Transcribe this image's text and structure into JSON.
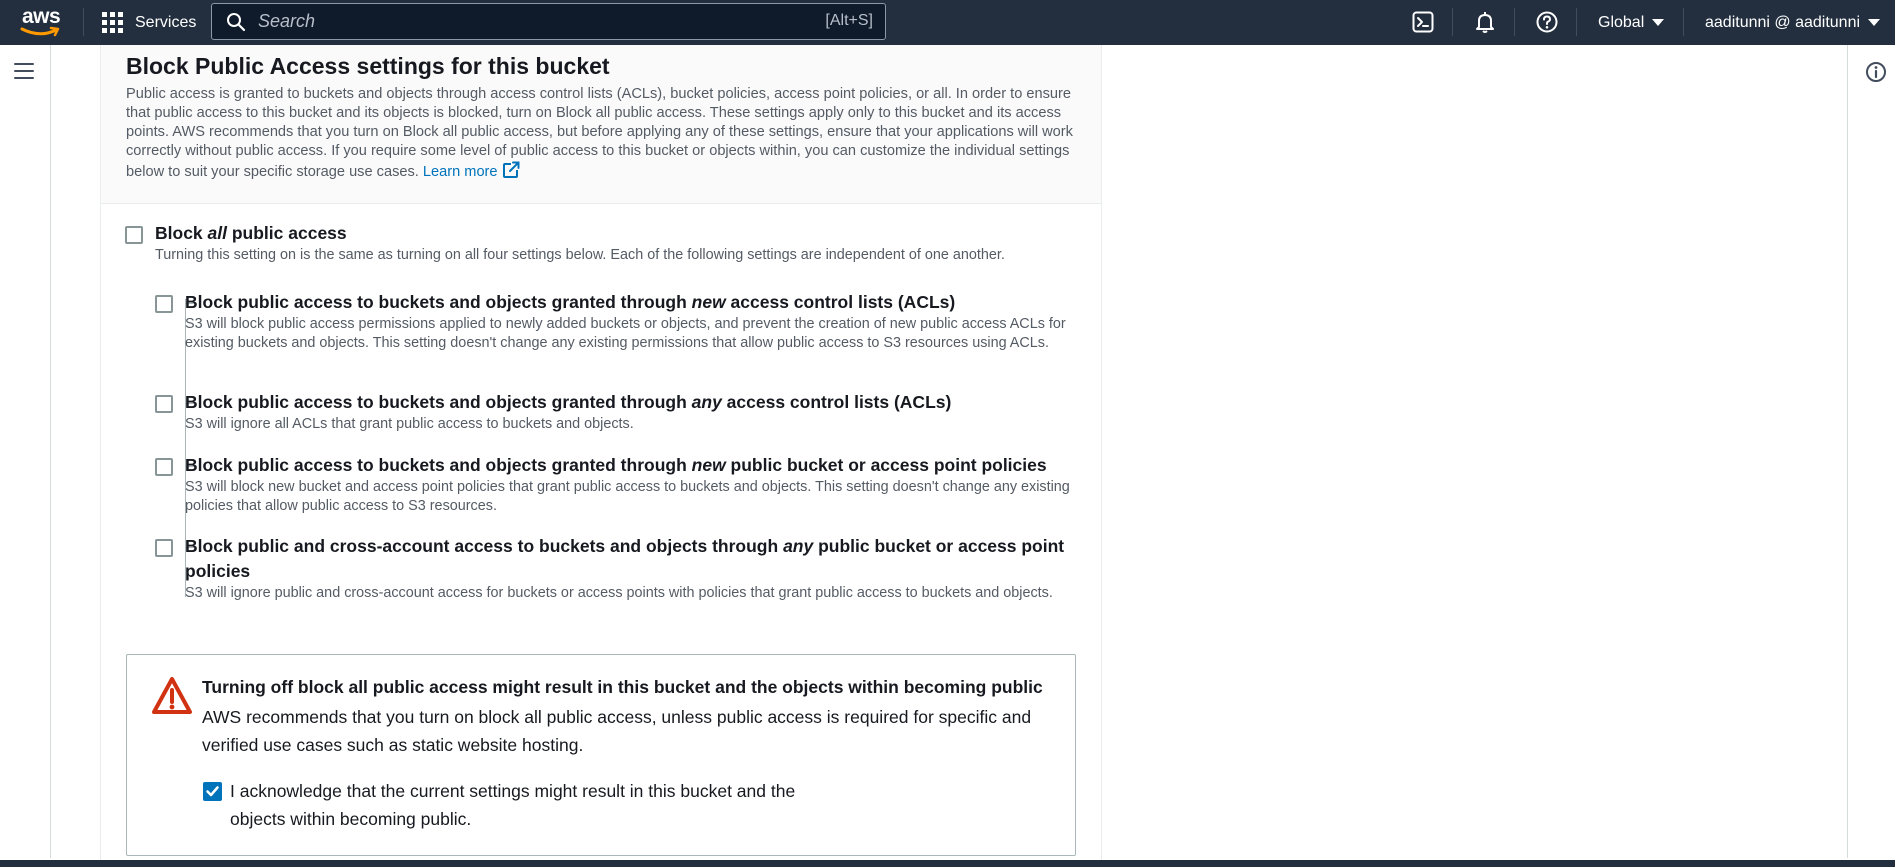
{
  "topnav": {
    "logo_text": "aws",
    "services_label": "Services",
    "search_placeholder": "Search",
    "search_shortcut": "[Alt+S]",
    "region_label": "Global",
    "account_label": "aaditunni @ aaditunni"
  },
  "section": {
    "title": "Block Public Access settings for this bucket",
    "description": "Public access is granted to buckets and objects through access control lists (ACLs), bucket policies, access point policies, or all. In order to ensure that public access to this bucket and its objects is blocked, turn on Block all public access. These settings apply only to this bucket and its access points. AWS recommends that you turn on Block all public access, but before applying any of these settings, ensure that your applications will work correctly without public access. If you require some level of public access to this bucket or objects within, you can customize the individual settings below to suit your specific storage use cases.",
    "learn_more": "Learn more"
  },
  "block_all": {
    "title_before": "Block ",
    "title_em": "all",
    "title_after": " public access",
    "description": "Turning this setting on is the same as turning on all four settings below. Each of the following settings are independent of one another.",
    "checked": false
  },
  "options": [
    {
      "title_before": "Block public access to buckets and objects granted through ",
      "title_em": "new",
      "title_after": " access control lists (ACLs)",
      "description": "S3 will block public access permissions applied to newly added buckets or objects, and prevent the creation of new public access ACLs for existing buckets and objects. This setting doesn't change any existing permissions that allow public access to S3 resources using ACLs.",
      "checked": false
    },
    {
      "title_before": "Block public access to buckets and objects granted through ",
      "title_em": "any",
      "title_after": " access control lists (ACLs)",
      "description": "S3 will ignore all ACLs that grant public access to buckets and objects.",
      "checked": false
    },
    {
      "title_before": "Block public access to buckets and objects granted through ",
      "title_em": "new",
      "title_after": " public bucket or access point policies",
      "description": "S3 will block new bucket and access point policies that grant public access to buckets and objects. This setting doesn't change any existing policies that allow public access to S3 resources.",
      "checked": false
    },
    {
      "title_before": "Block public and cross-account access to buckets and objects through ",
      "title_em": "any",
      "title_after": " public bucket or access point",
      "title_line2": "policies",
      "description": "S3 will ignore public and cross-account access for buckets or access points with policies that grant public access to buckets and objects.",
      "checked": false
    }
  ],
  "warning": {
    "title": "Turning off block all public access might result in this bucket and the objects within becoming public",
    "text": "AWS recommends that you turn on block all public access, unless public access is required for specific and verified use cases such as static website hosting.",
    "ack_label": "I acknowledge that the current settings might result in this bucket and the objects within becoming public.",
    "ack_checked": true
  },
  "icons": {
    "services": "grid-icon",
    "search": "search-icon",
    "cloudshell": "cloudshell-icon",
    "notifications": "bell-icon",
    "help": "help-icon",
    "menu": "hamburger-icon",
    "info": "info-icon",
    "warning": "warning-triangle-icon",
    "external": "external-link-icon"
  },
  "colors": {
    "nav_bg": "#232f3e",
    "link": "#0073bb",
    "warning_red": "#d13212",
    "checkbox_checked": "#0073bb"
  }
}
